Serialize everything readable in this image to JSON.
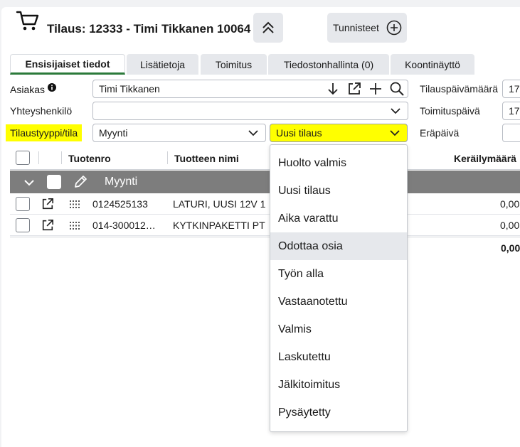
{
  "header": {
    "title": "Tilaus: 12333 - Timi Tikkanen 10064",
    "tags_label": "Tunnisteet"
  },
  "tabs": [
    {
      "label": "Ensisijaiset tiedot"
    },
    {
      "label": "Lisätietoja"
    },
    {
      "label": "Toimitus"
    },
    {
      "label": "Tiedostonhallinta (0)"
    },
    {
      "label": "Koontinäyttö"
    }
  ],
  "form": {
    "customer_label": "Asiakas",
    "customer_value": "Timi Tikkanen",
    "contact_label": "Yhteyshenkilö",
    "contact_value": "",
    "type_label": "Tilaustyyppi/tila",
    "type_value": "Myynti",
    "status_value": "Uusi tilaus",
    "order_date_label": "Tilauspäivämäärä",
    "order_date_value": "17",
    "delivery_date_label": "Toimituspäivä",
    "delivery_date_value": "17",
    "due_date_label": "Eräpäivä",
    "due_date_value": ""
  },
  "table": {
    "headers": {
      "product_no": "Tuotenro",
      "product_name": "Tuotteen nimi",
      "pick_qty": "Keräilymäärä"
    },
    "group_label": "Myynti",
    "rows": [
      {
        "product_no": "0124525133",
        "product_name": "LATURI, UUSI 12V 1",
        "qty": "0,00"
      },
      {
        "product_no": "014-300012…",
        "product_name": "KYTKINPAKETTI PT",
        "qty": "0,00"
      }
    ],
    "total": "0,00"
  },
  "status_dropdown": {
    "options": [
      "Huolto valmis",
      "Uusi tilaus",
      "Aika varattu",
      "Odottaa osia",
      "Työn alla",
      "Vastaanotettu",
      "Valmis",
      "Laskutettu",
      "Jälkitoimitus",
      "Pysäytetty"
    ],
    "hovered": "Odottaa osia"
  },
  "colors": {
    "highlight": "#ffff00",
    "active_tab_underline": "#2b7a3a",
    "group_row": "#7d7d7d"
  }
}
